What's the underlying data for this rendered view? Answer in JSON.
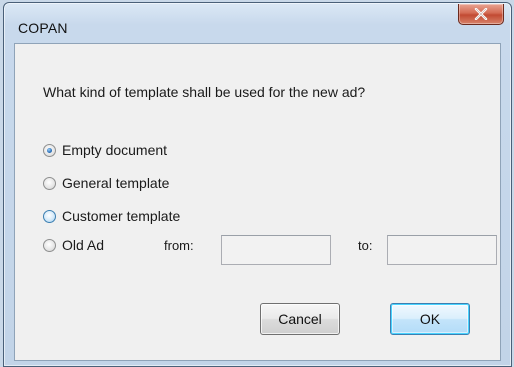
{
  "window": {
    "title": "COPAN",
    "close_symbol": "X"
  },
  "dialog": {
    "question": "What kind of template shall be used for the new ad?",
    "options": [
      {
        "label": "Empty document",
        "checked": true
      },
      {
        "label": "General template",
        "checked": false
      },
      {
        "label": "Customer template",
        "checked": false
      },
      {
        "label": "Old Ad",
        "checked": false
      }
    ],
    "from_label": "from:",
    "from_value": "",
    "to_label": "to:",
    "to_value": ""
  },
  "buttons": {
    "cancel_label": "Cancel",
    "ok_label": "OK"
  },
  "colors": {
    "titlebar": "#c8d9ec",
    "close_button": "#c24a33",
    "client_background": "#f0f0f0",
    "default_button_border": "#3c7fb1"
  },
  "icons": {
    "close": "close-icon",
    "radio": "radio-button"
  }
}
